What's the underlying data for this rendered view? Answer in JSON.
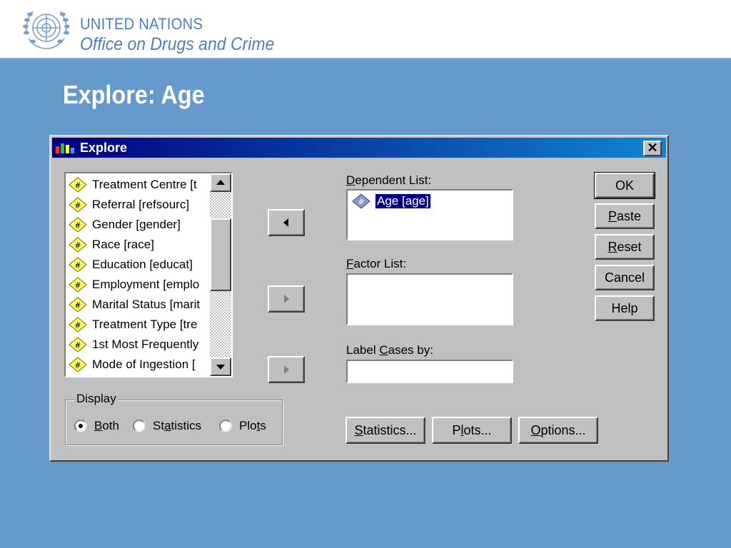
{
  "header": {
    "org_line1": "UNITED NATIONS",
    "org_line2": "Office on Drugs and Crime",
    "logo_icon": "un-emblem-icon"
  },
  "slide": {
    "title": "Explore: Age"
  },
  "colors": {
    "background": "#6699cc",
    "titlebar": "#000080",
    "header_text": "#4e7fb4"
  },
  "window": {
    "title": "Explore",
    "close_label": "✕",
    "variables": [
      "Treatment Centre [t",
      "Referral [refsourc]",
      "Gender [gender]",
      "Race [race]",
      "Education [educat]",
      "Employment [emplo",
      "Marital Status [marit",
      "Treatment Type [tre",
      "1st Most Frequently",
      "Mode of Ingestion ["
    ],
    "dependent_list": {
      "label_prefix": "",
      "label_ul": "D",
      "label_rest": "ependent List:",
      "items": [
        "Age [age]"
      ]
    },
    "factor_list": {
      "label_ul": "F",
      "label_rest": "actor List:"
    },
    "label_cases": {
      "label_prefix": "Label ",
      "label_ul": "C",
      "label_rest": "ases by:",
      "value": ""
    },
    "buttons": {
      "ok": "OK",
      "paste_ul": "P",
      "paste_rest": "aste",
      "reset_ul": "R",
      "reset_rest": "eset",
      "cancel": "Cancel",
      "help": "Help",
      "statistics_ul": "S",
      "statistics_rest": "tatistics...",
      "plots_pre": "P",
      "plots_ul": "l",
      "plots_rest": "ots...",
      "options_ul": "O",
      "options_rest": "ptions..."
    },
    "display": {
      "title": "Display",
      "both_ul": "B",
      "both_rest": "oth",
      "stats_pre": "St",
      "stats_ul": "a",
      "stats_rest": "tistics",
      "plots_pre": "Plo",
      "plots_ul": "t",
      "plots_rest": "s",
      "selected": "Both"
    }
  }
}
